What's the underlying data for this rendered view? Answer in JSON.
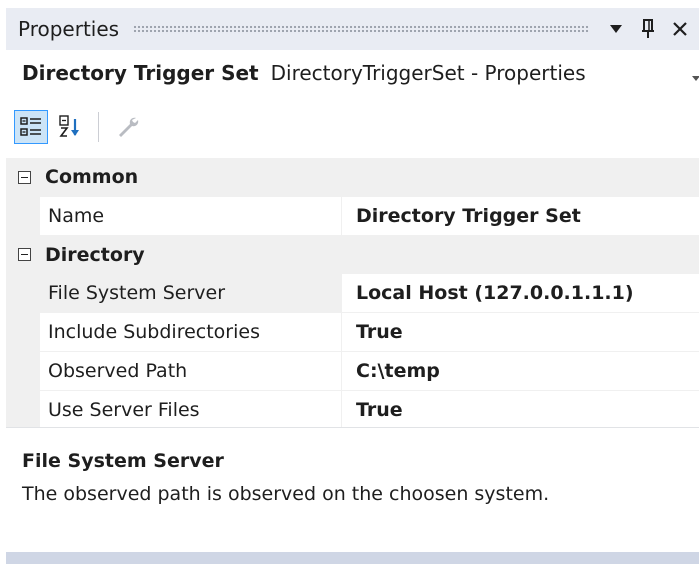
{
  "window": {
    "title": "Properties"
  },
  "selector": {
    "type_label": "Directory Trigger Set",
    "name_label": "DirectoryTriggerSet - Properties"
  },
  "toolbar": {
    "categorized_icon": "categorized-icon",
    "alphabetical_icon": "alphabetical-icon",
    "property_pages_icon": "wrench-icon"
  },
  "categories": [
    {
      "label": "Common",
      "properties": [
        {
          "name": "Name",
          "value": "Directory Trigger Set"
        }
      ]
    },
    {
      "label": "Directory",
      "properties": [
        {
          "name": "File System Server",
          "value": "Local Host (127.0.0.1.1.1)"
        },
        {
          "name": "Include Subdirectories",
          "value": "True"
        },
        {
          "name": "Observed Path",
          "value": "C:\\temp"
        },
        {
          "name": "Use Server Files",
          "value": "True"
        }
      ]
    }
  ],
  "description": {
    "title": "File System Server",
    "text": "The observed path is observed on the choosen system."
  },
  "colors": {
    "title_bar": "#e9ecf3",
    "category_background": "#f0f0f0",
    "active_tool_border": "#3399ff",
    "active_tool_fill": "#cce4f7",
    "status_strip": "#cfd6e5"
  }
}
